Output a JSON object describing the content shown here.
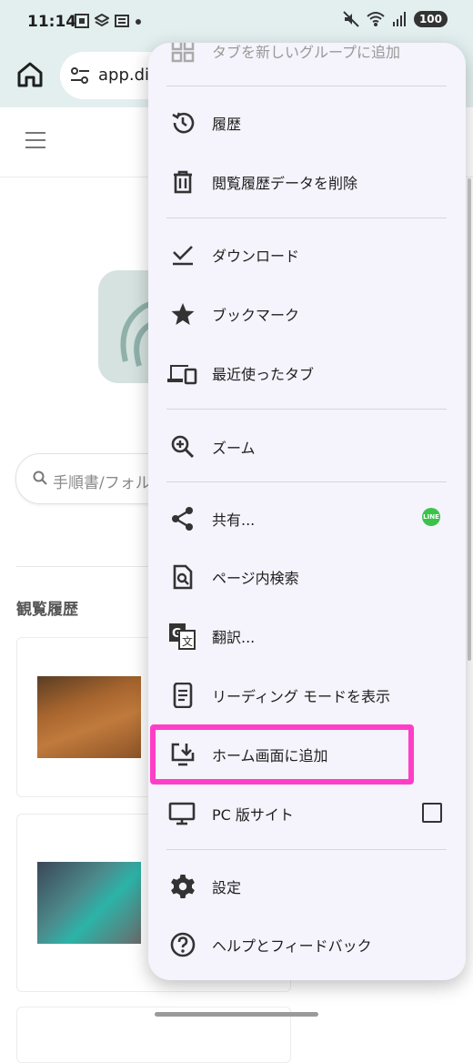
{
  "status_bar": {
    "time": "11:14",
    "battery": "100"
  },
  "address_bar": {
    "url": "app.div"
  },
  "page": {
    "search_placeholder": "手順書/フォル",
    "history_heading": "観覧履歴"
  },
  "menu": {
    "items": [
      {
        "label": "タブを新しいグループに追加",
        "icon": "add-to-group-icon"
      },
      {
        "label": "履歴",
        "icon": "history-icon"
      },
      {
        "label": "閲覧履歴データを削除",
        "icon": "trash-icon"
      },
      {
        "label": "ダウンロード",
        "icon": "download-check-icon"
      },
      {
        "label": "ブックマーク",
        "icon": "star-icon"
      },
      {
        "label": "最近使ったタブ",
        "icon": "devices-icon"
      },
      {
        "label": "ズーム",
        "icon": "zoom-in-icon"
      },
      {
        "label": "共有...",
        "icon": "share-icon"
      },
      {
        "label": "ページ内検索",
        "icon": "find-in-page-icon"
      },
      {
        "label": "翻訳...",
        "icon": "translate-icon"
      },
      {
        "label": "リーディング モードを表示",
        "icon": "reading-mode-icon"
      },
      {
        "label": "ホーム画面に追加",
        "icon": "add-to-home-icon"
      },
      {
        "label": "PC 版サイト",
        "icon": "desktop-icon",
        "checked": false
      },
      {
        "label": "設定",
        "icon": "gear-icon"
      },
      {
        "label": "ヘルプとフィードバック",
        "icon": "help-icon"
      }
    ],
    "share_badge": "LINE",
    "highlight_color": "#ff3ec8"
  }
}
